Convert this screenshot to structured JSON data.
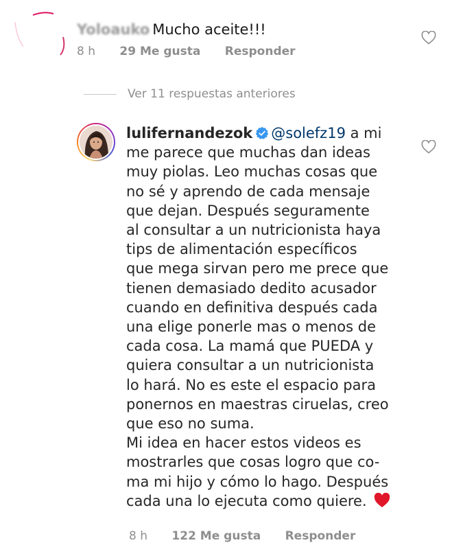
{
  "top_comment": {
    "username_blurred": "Yoloauko",
    "text": "Mucho aceite!!!",
    "time": "8 h",
    "likes": "29 Me gusta",
    "reply_label": "Responder"
  },
  "view_replies_label": "Ver 11 respuestas anteriores",
  "main_comment": {
    "username": "lulifernandezok",
    "mention": "@solefz19",
    "line1_after_mention": " a mi",
    "lines": [
      "me parece que muchas dan ideas",
      "muy piolas. Leo muchas cosas que",
      "no sé y aprendo de cada mensaje",
      "que dejan. Después seguramente",
      "al consultar a un nutricionista haya",
      "tips de alimentación específicos",
      "que mega sirvan pero me prece que",
      "tienen demasiado dedito acusador",
      "cuando en definitiva después cada",
      "una elige ponerle mas o menos de",
      "cada cosa. La mamá que PUEDA y",
      "quiera consultar a un nutricionista",
      "lo hará. No es este el espacio para",
      "ponernos en maestras ciruelas, creo",
      "que eso no suma.",
      "Mi idea en hacer estos videos es",
      "mostrarles que cosas logro que co-",
      "ma mi hijo y cómo lo hago. Después"
    ],
    "last_line": "cada una lo ejecuta como quiere.",
    "time": "8 h",
    "likes": "122 Me gusta",
    "reply_label": "Responder"
  },
  "icons": {
    "like": "heart-outline-icon",
    "verified": "verified-badge-icon",
    "emoji": "red-heart-emoji"
  },
  "colors": {
    "text": "#262626",
    "meta": "#8e8e8e",
    "mention": "#00376b",
    "verified": "#3897f0",
    "heart_emoji": "#e0162b"
  }
}
